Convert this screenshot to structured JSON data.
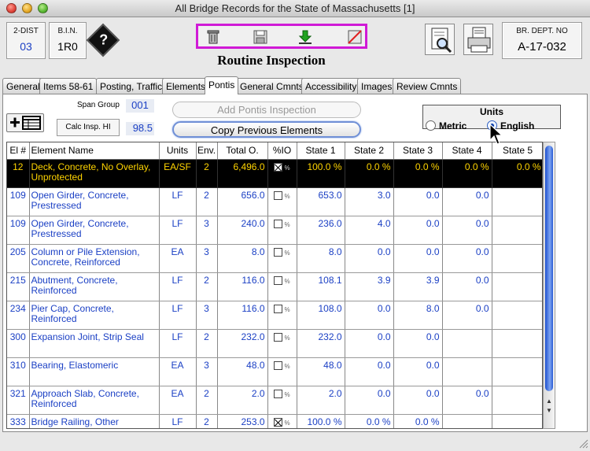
{
  "window": {
    "title": "All Bridge Records for the State of Massachusetts [1]"
  },
  "header": {
    "dist_label": "2-DIST",
    "dist_value": "03",
    "bin_label": "B.I.N.",
    "bin_value": "1R0",
    "br_dept_label": "BR. DEPT. NO",
    "br_dept_value": "A-17-032",
    "form_title": "Routine Inspection",
    "help_glyph": "?"
  },
  "toolbar": {
    "icons": [
      "trash-icon",
      "save-icon",
      "down-arrow-icon",
      "cancel-icon"
    ],
    "accent": "#d01ad6"
  },
  "tabs": [
    {
      "label": "General"
    },
    {
      "label": "Items 58-61"
    },
    {
      "label": "Posting, Traffic"
    },
    {
      "label": "Elements"
    },
    {
      "label": "Pontis"
    },
    {
      "label": "General Cmnts"
    },
    {
      "label": "Accessibility"
    },
    {
      "label": "Images"
    },
    {
      "label": "Review Cmnts"
    }
  ],
  "pontis": {
    "span_group_label": "Span Group",
    "span_group_value": "001",
    "calc_label": "Calc Insp. HI",
    "calc_value": "98.5",
    "add_button": "Add Pontis Inspection",
    "copy_button": "Copy Previous Elements",
    "units": {
      "title": "Units",
      "metric": "Metric",
      "english": "English",
      "selected": "English"
    }
  },
  "table": {
    "columns": [
      "El #",
      "Element Name",
      "Units",
      "Env.",
      "Total O.",
      "%IO",
      "State 1",
      "State 2",
      "State 3",
      "State 4",
      "State 5"
    ],
    "rows": [
      {
        "el": "12",
        "name": "Deck, Concrete, No Overlay, Unprotected",
        "units": "EA/SF",
        "env": "2",
        "total": "6,496.0",
        "pctio": true,
        "s1": "100.0 %",
        "s2": "0.0 %",
        "s3": "0.0 %",
        "s4": "0.0 %",
        "s5": "0.0 %",
        "selected": true
      },
      {
        "el": "109",
        "name": "Open Girder, Concrete, Prestressed",
        "units": "LF",
        "env": "2",
        "total": "656.0",
        "pctio": false,
        "s1": "653.0",
        "s2": "3.0",
        "s3": "0.0",
        "s4": "0.0",
        "s5": ""
      },
      {
        "el": "109",
        "name": "Open Girder, Concrete, Prestressed",
        "units": "LF",
        "env": "3",
        "total": "240.0",
        "pctio": false,
        "s1": "236.0",
        "s2": "4.0",
        "s3": "0.0",
        "s4": "0.0",
        "s5": ""
      },
      {
        "el": "205",
        "name": "Column or Pile Extension, Concrete, Reinforced",
        "units": "EA",
        "env": "3",
        "total": "8.0",
        "pctio": false,
        "s1": "8.0",
        "s2": "0.0",
        "s3": "0.0",
        "s4": "0.0",
        "s5": ""
      },
      {
        "el": "215",
        "name": "Abutment, Concrete, Reinforced",
        "units": "LF",
        "env": "2",
        "total": "116.0",
        "pctio": false,
        "s1": "108.1",
        "s2": "3.9",
        "s3": "3.9",
        "s4": "0.0",
        "s5": ""
      },
      {
        "el": "234",
        "name": "Pier Cap, Concrete, Reinforced",
        "units": "LF",
        "env": "3",
        "total": "116.0",
        "pctio": false,
        "s1": "108.0",
        "s2": "0.0",
        "s3": "8.0",
        "s4": "0.0",
        "s5": ""
      },
      {
        "el": "300",
        "name": "Expansion Joint, Strip Seal",
        "units": "LF",
        "env": "2",
        "total": "232.0",
        "pctio": false,
        "s1": "232.0",
        "s2": "0.0",
        "s3": "0.0",
        "s4": "",
        "s5": ""
      },
      {
        "el": "310",
        "name": "Bearing, Elastomeric",
        "units": "EA",
        "env": "3",
        "total": "48.0",
        "pctio": false,
        "s1": "48.0",
        "s2": "0.0",
        "s3": "0.0",
        "s4": "",
        "s5": ""
      },
      {
        "el": "321",
        "name": "Approach Slab, Concrete, Reinforced",
        "units": "EA",
        "env": "2",
        "total": "2.0",
        "pctio": false,
        "s1": "2.0",
        "s2": "0.0",
        "s3": "0.0",
        "s4": "0.0",
        "s5": ""
      },
      {
        "el": "333",
        "name": "Bridge Railing, Other",
        "units": "LF",
        "env": "2",
        "total": "253.0",
        "pctio": true,
        "s1": "100.0 %",
        "s2": "0.0 %",
        "s3": "0.0 %",
        "s4": "",
        "s5": ""
      }
    ]
  },
  "colors": {
    "value_blue": "#1a3fc4",
    "selected_row_bg": "#000000",
    "selected_row_text": "#ffd400",
    "scroll_thumb": "#2a5cd5"
  }
}
